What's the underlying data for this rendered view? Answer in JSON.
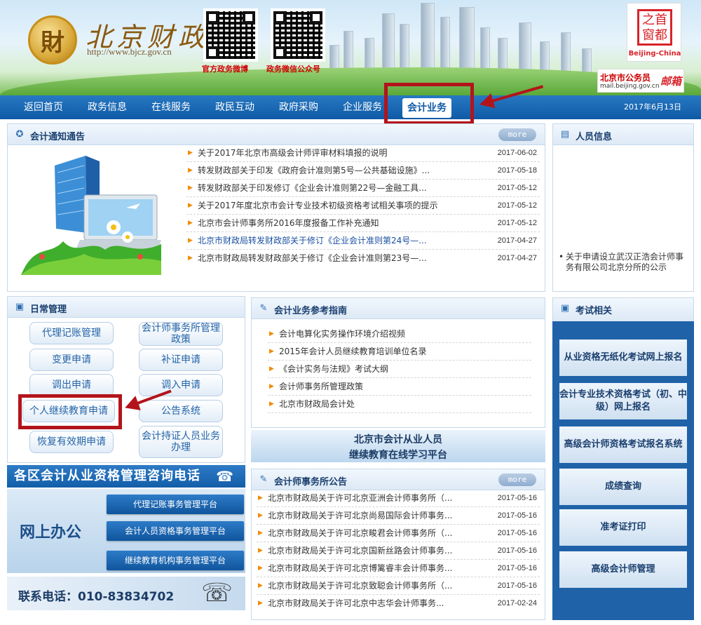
{
  "header": {
    "logo_glyph": "財",
    "logo_text": "北京财政",
    "logo_url": "http://www.bjcz.gov.cn",
    "qr_weibo_label": "官方政务微博",
    "qr_wechat_label": "政务微信公众号",
    "capital_seal_top": "之首",
    "capital_seal_bottom": "窗都",
    "capital_label": "Beijing-China",
    "mail_title": "北京市公务员",
    "mail_url": "mail.beijing.gov.cn",
    "mail_brand": "邮箱"
  },
  "nav": {
    "items": [
      "返回首页",
      "政务信息",
      "在线服务",
      "政民互动",
      "政府采购",
      "企业服务"
    ],
    "active": "会计业务",
    "date": "2017年6月13日"
  },
  "notice": {
    "title": "会计通知通告",
    "more": "more",
    "items": [
      {
        "title": "关于2017年北京市高级会计师评审材料填报的说明",
        "date": "2017-06-02"
      },
      {
        "title": "转发财政部关于印发《政府会计准则第5号—公共基础设施》...",
        "date": "2017-05-18"
      },
      {
        "title": "转发财政部关于印发修订《企业会计准则第22号—金融工具...",
        "date": "2017-05-12"
      },
      {
        "title": "关于2017年度北京市会计专业技术初级资格考试相关事项的提示",
        "date": "2017-05-12"
      },
      {
        "title": "北京市会计师事务所2016年度报备工作补充通知",
        "date": "2017-05-12"
      },
      {
        "title": "北京市财政局转发财政部关于修订《企业会计准则第24号—...",
        "date": "2017-04-27"
      },
      {
        "title": "北京市财政局转发财政部关于修订《企业会计准则第23号—...",
        "date": "2017-04-27"
      }
    ]
  },
  "personnel": {
    "title": "人员信息",
    "item": "关于申请设立武汉正浩会计师事务有限公司北京分所的公示"
  },
  "daily": {
    "title": "日常管理",
    "buttons": {
      "agency": "代理记账管理",
      "firm_policy": "会计师事务所管理政策",
      "change": "变更申请",
      "reissue": "补证申请",
      "transfer_out": "调出申请",
      "transfer_in": "调入申请",
      "continuing_edu": "个人继续教育申请",
      "announce": "公告系统",
      "restore": "恢复有效期申请",
      "certified": "会计持证人员业务办理"
    }
  },
  "phone_banner": "各区会计从业资格管理咨询电话",
  "online": {
    "label": "网上办公",
    "buttons": [
      "代理记账事务管理平台",
      "会计人员资格事务管理平台",
      "继续教育机构事务管理平台"
    ]
  },
  "contact": "联系电话：010-83834702",
  "guide": {
    "title": "会计业务参考指南",
    "items": [
      "会计电算化实务操作环境介绍视频",
      "2015年会计人员继续教育培训单位名录",
      "《会计实务与法规》考试大纲",
      "会计师事务所管理政策",
      "北京市财政局会计处"
    ]
  },
  "center_banner": {
    "line1": "北京市会计从业人员",
    "line2": "继续教育在线学习平台"
  },
  "firm": {
    "title": "会计师事务所公告",
    "more": "more",
    "items": [
      {
        "title": "北京市财政局关于许可北京亚洲会计师事务所（...",
        "date": "2017-05-16"
      },
      {
        "title": "北京市财政局关于许可北京尚易国际会计师事务...",
        "date": "2017-05-16"
      },
      {
        "title": "北京市财政局关于许可北京畯君会计师事务所（...",
        "date": "2017-05-16"
      },
      {
        "title": "北京市财政局关于许可北京国新丝路会计师事务...",
        "date": "2017-05-16"
      },
      {
        "title": "北京市财政局关于许可北京博篱睿丰会计师事务...",
        "date": "2017-05-16"
      },
      {
        "title": "北京市财政局关于许可北京致聪会计师事务所（...",
        "date": "2017-05-16"
      },
      {
        "title": "北京市财政局关于许可北京中志华会计师事务...",
        "date": "2017-02-24"
      }
    ]
  },
  "exam": {
    "title": "考试相关",
    "buttons": [
      "从业资格无纸化考试网上报名",
      "会计专业技术资格考试（初、中级）网上报名",
      "高级会计师资格考试报名系统",
      "成绩查询",
      "准考证打印",
      "高级会计师管理"
    ]
  },
  "colors": {
    "nav_blue": "#0f5aa6",
    "highlight_red": "#b3141b",
    "bullet_orange": "#f28a00"
  }
}
